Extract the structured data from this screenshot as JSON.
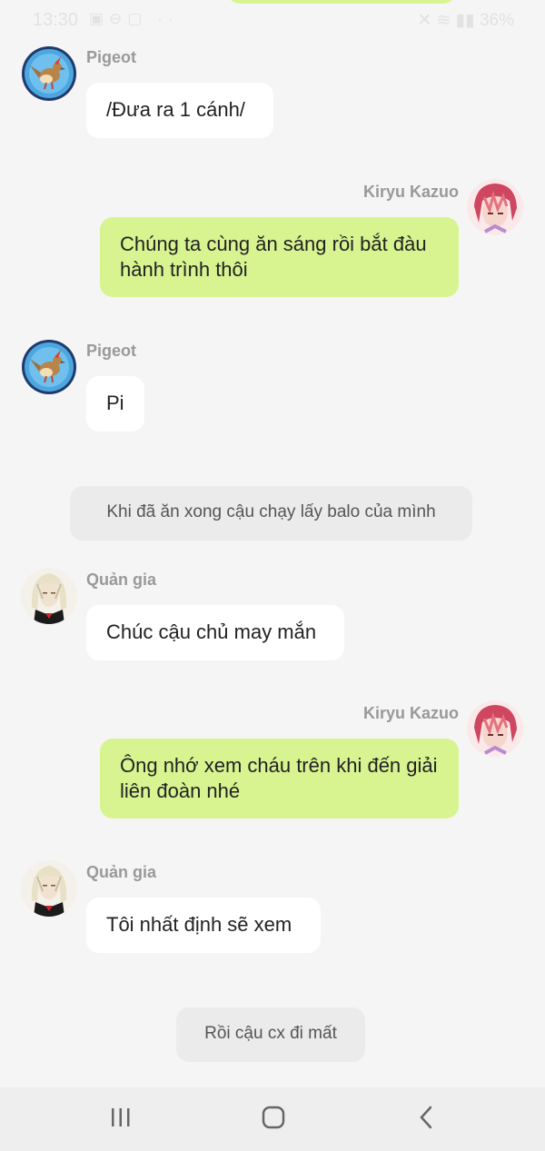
{
  "status_bar": {
    "time": "13:30",
    "battery": "36%"
  },
  "messages": [
    {
      "type": "incoming",
      "sender": "Pigeot",
      "text": "/Đưa ra 1 cánh/"
    },
    {
      "type": "outgoing",
      "sender": "Kiryu Kazuo",
      "text": "Chúng ta cùng ăn sáng rồi bắt đàu hành trình thôi"
    },
    {
      "type": "incoming",
      "sender": "Pigeot",
      "text": "Pi"
    },
    {
      "type": "narration",
      "text": "Khi đã ăn xong cậu chạy lấy balo của mình"
    },
    {
      "type": "incoming",
      "sender": "Quản gia",
      "text": "Chúc cậu chủ may mắn"
    },
    {
      "type": "outgoing",
      "sender": "Kiryu Kazuo",
      "text": "Ông nhớ xem cháu trên khi đến giải liên đoàn nhé"
    },
    {
      "type": "incoming",
      "sender": "Quản gia",
      "text": "Tôi nhất định sẽ xem"
    },
    {
      "type": "narration",
      "text": "Rồi cậu cx đi mất"
    }
  ],
  "avatars": {
    "pigeot": "pigeot-bird-avatar",
    "kiryu": "red-haired-boy-avatar",
    "butler": "white-haired-butler-avatar"
  },
  "nav_bar": {
    "recent_icon": "recent-apps-icon",
    "home_icon": "home-icon",
    "back_icon": "back-icon"
  },
  "colors": {
    "outgoing_bubble": "#d7f491",
    "incoming_bubble": "#ffffff",
    "narration_bubble": "#ebebeb",
    "background": "#f5f5f5"
  }
}
